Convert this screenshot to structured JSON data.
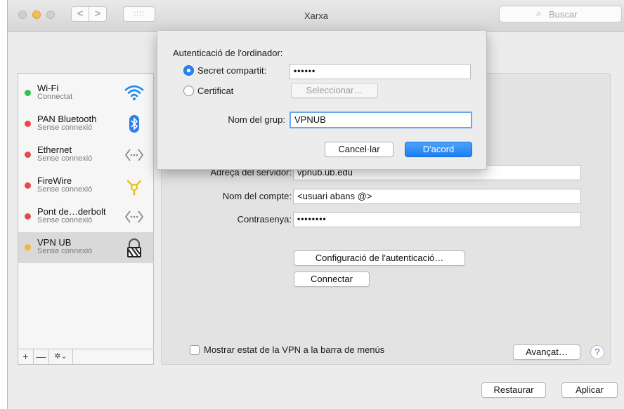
{
  "window": {
    "title": "Xarxa",
    "search_placeholder": "Buscar",
    "nav_back": "<",
    "nav_forward": ">",
    "grid": "::::"
  },
  "sidebar": {
    "items": [
      {
        "name": "Wi-Fi",
        "status": "Connectat",
        "dot_color": "#2fc24d",
        "icon": "wifi-icon"
      },
      {
        "name": "PAN Bluetooth",
        "status": "Sense connexió",
        "dot_color": "#e8474b",
        "icon": "bluetooth-icon"
      },
      {
        "name": "Ethernet",
        "status": "Sense connexió",
        "dot_color": "#e8474b",
        "icon": "ethernet-icon"
      },
      {
        "name": "FireWire",
        "status": "Sense connexió",
        "dot_color": "#e8474b",
        "icon": "firewire-icon"
      },
      {
        "name": "Pont de…derbolt",
        "status": "Sense connexió",
        "dot_color": "#e8474b",
        "icon": "thunderbolt-bridge-icon"
      },
      {
        "name": "VPN UB",
        "status": "Sense connexió",
        "dot_color": "#f2b632",
        "icon": "vpn-lock-icon"
      }
    ],
    "add": "+",
    "remove": "—",
    "gear": "✲⌄"
  },
  "detail": {
    "server_label": "Adreça del servidor:",
    "server_value": "vpnub.ub.edu",
    "account_label": "Nom del compte:",
    "account_value": "<usuari abans @>",
    "password_label": "Contrasenya:",
    "password_value": "••••••••",
    "auth_settings_button": "Configuració de l'autenticació…",
    "connect_button": "Connectar",
    "show_status_label": "Mostrar estat de la VPN a la barra de menús",
    "advanced_button": "Avançat…",
    "help": "?"
  },
  "footer": {
    "revert_button": "Restaurar",
    "apply_button": "Aplicar"
  },
  "sheet": {
    "heading": "Autenticació de l'ordinador:",
    "shared_secret_label": "Secret compartit:",
    "shared_secret_value": "••••••",
    "certificate_label": "Certificat",
    "select_button": "Seleccionar…",
    "group_label": "Nom del grup:",
    "group_value": "VPNUB",
    "cancel_button": "Cancel·lar",
    "ok_button": "D'acord"
  }
}
